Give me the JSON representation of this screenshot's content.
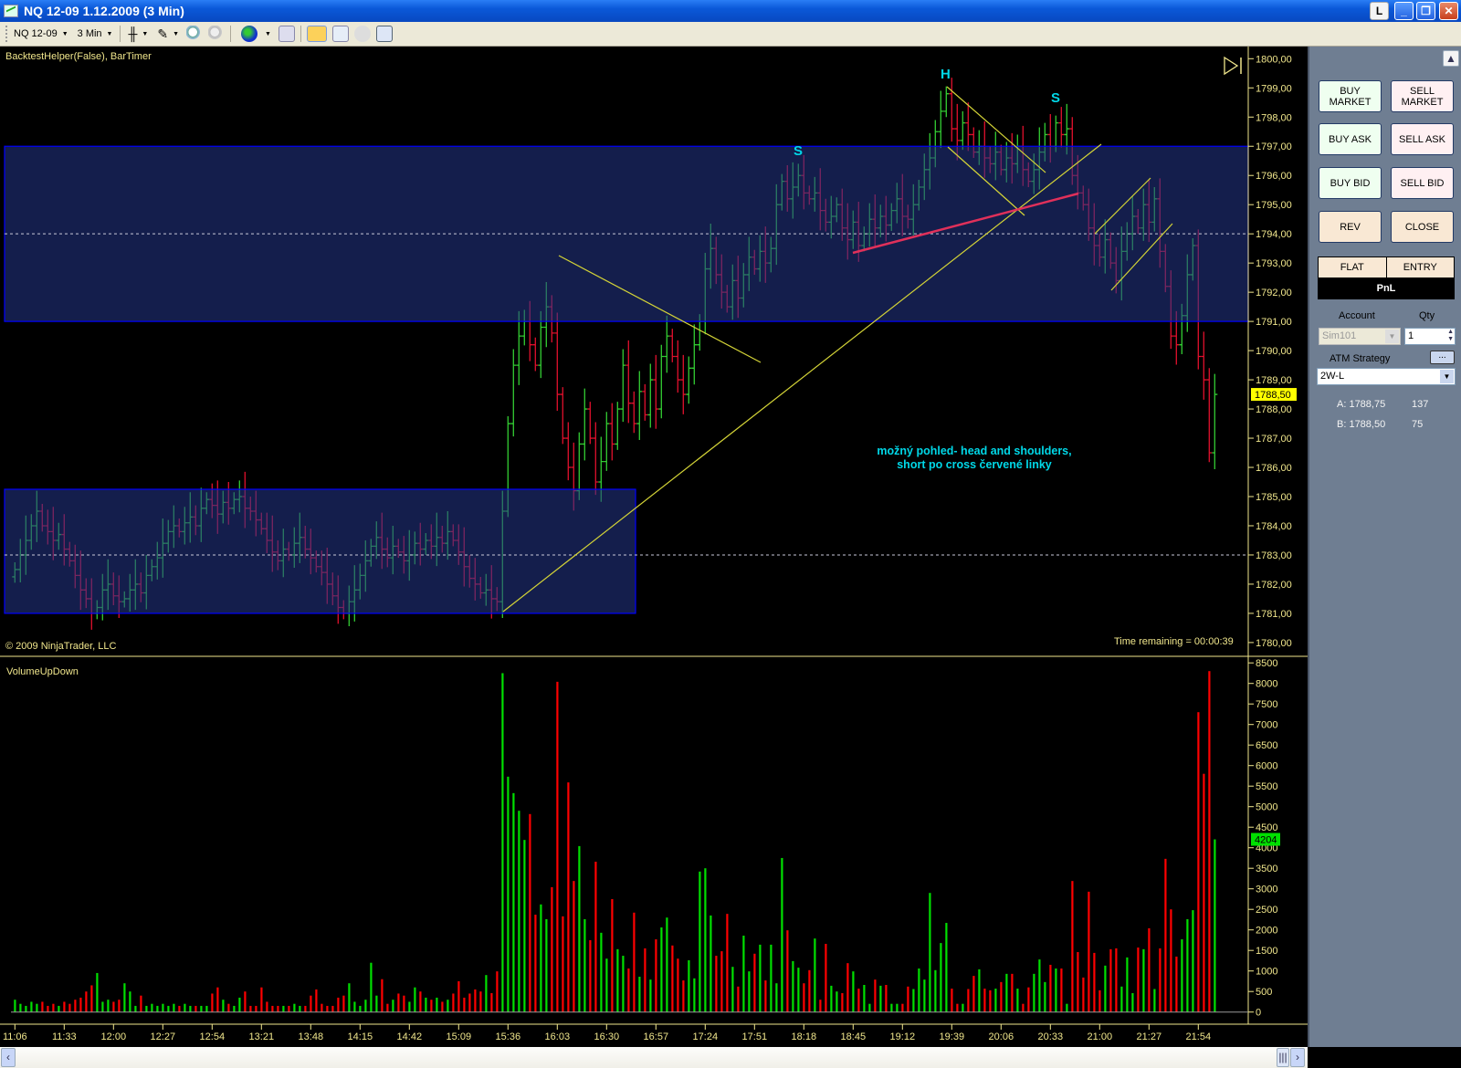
{
  "window": {
    "title": "NQ 12-09  1.12.2009 (3 Min)",
    "btn_l": "L",
    "btn_min": "_",
    "btn_max": "❐",
    "btn_close": "✕"
  },
  "toolbar": {
    "instrument": "NQ 12-09",
    "interval": "3 Min"
  },
  "chart": {
    "indicator_label": "BacktestHelper(False), BarTimer",
    "copyright": "© 2009 NinjaTrader, LLC",
    "time_remaining": "Time remaining = 00:00:39",
    "volume_label": "VolumeUpDown",
    "annotation_line1": "možný pohled- head and shoulders,",
    "annotation_line2": "short po cross červené linky",
    "pattern_labels": {
      "left_shoulder": "S",
      "head": "H",
      "right_shoulder": "S"
    },
    "current_price_label": "1788,50",
    "current_volume_label": "4204",
    "colors": {
      "up": "#32cd32",
      "down": "#e0102c",
      "box_fill": "#24378a",
      "box_stroke": "#0000ff",
      "axis": "#f0e68c",
      "annotation": "#00d8e8",
      "price_tag": "#ffff00",
      "volume_tag": "#00e000"
    }
  },
  "chart_data": {
    "type": "ohlc+volume",
    "title": "NQ 12-09 1.12.2009 (3 Min)",
    "price_ylim": [
      1780,
      1800
    ],
    "price_ticks": [
      "1800,00",
      "1799,00",
      "1798,00",
      "1797,00",
      "1796,00",
      "1795,00",
      "1794,00",
      "1793,00",
      "1792,00",
      "1791,00",
      "1790,00",
      "1789,00",
      "1788,00",
      "1787,00",
      "1786,00",
      "1785,00",
      "1784,00",
      "1783,00",
      "1782,00",
      "1781,00",
      "1780,00"
    ],
    "volume_ylim": [
      0,
      8500
    ],
    "volume_ticks": [
      "8500",
      "8000",
      "7500",
      "7000",
      "6500",
      "6000",
      "5500",
      "5000",
      "4500",
      "4000",
      "3500",
      "3000",
      "2500",
      "2000",
      "1500",
      "1000",
      "500",
      "0"
    ],
    "time_ticks": [
      "11:06",
      "11:33",
      "12:00",
      "12:27",
      "12:54",
      "13:21",
      "13:48",
      "14:15",
      "14:42",
      "15:09",
      "15:36",
      "16:03",
      "16:30",
      "16:57",
      "17:24",
      "17:51",
      "18:18",
      "18:45",
      "19:12",
      "19:39",
      "20:06",
      "20:33",
      "21:00",
      "21:27",
      "21:54"
    ],
    "zones": [
      {
        "from": 1791,
        "to": 1797
      },
      {
        "from": 1781,
        "to": 1785.25
      }
    ],
    "close": [
      1782.5,
      1783,
      1783.5,
      1784,
      1784.5,
      1784,
      1783.8,
      1783.5,
      1783.7,
      1783.2,
      1782.8,
      1782.3,
      1781.8,
      1781.5,
      1781,
      1781.2,
      1781.8,
      1782,
      1781.6,
      1781.4,
      1781.5,
      1781.8,
      1782,
      1781.7,
      1782.3,
      1782.6,
      1782.9,
      1783.4,
      1783.8,
      1784,
      1783.8,
      1784.1,
      1784.3,
      1784,
      1784.6,
      1784.9,
      1784.7,
      1784.4,
      1784.8,
      1784.6,
      1784.9,
      1785,
      1784.6,
      1784.5,
      1784.2,
      1783.9,
      1783.5,
      1783.1,
      1782.8,
      1783.2,
      1783,
      1783.4,
      1783.6,
      1783.2,
      1782.9,
      1782.6,
      1782.4,
      1782,
      1781.6,
      1781.2,
      1781,
      1781.4,
      1781.8,
      1782.3,
      1782.8,
      1783.3,
      1783.6,
      1783.2,
      1782.9,
      1783.3,
      1783.1,
      1782.8,
      1783,
      1783.4,
      1783.2,
      1783.5,
      1783.3,
      1783.6,
      1783.4,
      1783.8,
      1783.5,
      1783.1,
      1782.6,
      1782.2,
      1782,
      1781.7,
      1781.8,
      1781.5,
      1781.4,
      1784.5,
      1787.5,
      1789.5,
      1790.5,
      1791,
      1790.2,
      1789.5,
      1790.8,
      1791.5,
      1790.6,
      1788.5,
      1787,
      1786,
      1785.2,
      1786.8,
      1788,
      1787,
      1785.5,
      1786.2,
      1787.5,
      1786.8,
      1788,
      1789.5,
      1788.2,
      1787.5,
      1788.6,
      1787.8,
      1789,
      1788,
      1789.8,
      1790.5,
      1789.8,
      1789,
      1788.5,
      1789.4,
      1790.2,
      1791,
      1792.8,
      1793.5,
      1792.6,
      1792,
      1791.5,
      1792.4,
      1791.8,
      1792.6,
      1793.2,
      1792.8,
      1793.4,
      1793,
      1793.5,
      1795,
      1795.8,
      1795.2,
      1795.6,
      1796,
      1795.4,
      1795.2,
      1795.4,
      1794.8,
      1794.4,
      1794.6,
      1795,
      1794.2,
      1793.8,
      1794.4,
      1793.6,
      1794,
      1794.5,
      1794.2,
      1794.6,
      1794.3,
      1794.8,
      1795.2,
      1794.6,
      1794.5,
      1795,
      1795.6,
      1796.2,
      1796.6,
      1797.5,
      1798.2,
      1798.8,
      1797.6,
      1797.2,
      1797.8,
      1797.4,
      1796.8,
      1797,
      1796.6,
      1796.4,
      1796.8,
      1796.2,
      1796.6,
      1796.4,
      1797,
      1796.2,
      1795.8,
      1796.2,
      1796.8,
      1797.4,
      1797,
      1797.8,
      1797.4,
      1797.6,
      1796,
      1795.4,
      1795,
      1794.2,
      1793.6,
      1793.2,
      1793.8,
      1793,
      1792.4,
      1793.4,
      1794,
      1794.6,
      1794.2,
      1795,
      1794.4,
      1795.2,
      1793.4,
      1792.2,
      1790.5,
      1790.2,
      1791.2,
      1792.6,
      1793.6,
      1789.8,
      1789,
      1786.5,
      1788.5
    ],
    "volume": [
      300,
      200,
      150,
      250,
      200,
      250,
      150,
      200,
      150,
      250,
      200,
      300,
      350,
      500,
      650,
      950,
      250,
      300,
      250,
      300,
      700,
      500,
      150,
      400,
      150,
      200,
      150,
      200,
      150,
      200,
      150,
      200,
      150,
      150,
      150,
      150,
      450,
      600,
      300,
      200,
      150,
      350,
      500,
      150,
      150,
      600,
      250,
      150,
      150,
      150,
      150,
      200,
      150,
      150,
      400,
      550,
      200,
      150,
      150,
      350,
      400,
      700,
      250,
      150,
      300,
      1200,
      400,
      800,
      200,
      300,
      450,
      400,
      250,
      600,
      500,
      350,
      300,
      350,
      250,
      300,
      450,
      750,
      350,
      450,
      550,
      500,
      900,
      460,
      990,
      8250,
      5730,
      5330,
      4900,
      4190,
      4820,
      2370,
      2620,
      2260,
      3040,
      8040,
      2330,
      5590,
      3190,
      4040,
      2260,
      1750,
      3660,
      1930,
      1300,
      2750,
      1530,
      1370,
      1060,
      2420,
      860,
      1550,
      790,
      1770,
      2060,
      2300,
      1620,
      1300,
      770,
      1260,
      820,
      3420,
      3500,
      2350,
      1370,
      1480,
      2390,
      1100,
      620,
      1860,
      990,
      1420,
      1640,
      770,
      1640,
      700,
      3750,
      1990,
      1240,
      1080,
      700,
      1020,
      1790,
      300,
      1660,
      640,
      500,
      460,
      1190,
      990,
      570,
      660,
      200,
      790,
      640,
      660,
      200,
      200,
      200,
      620,
      560,
      1060,
      790,
      2900,
      1020,
      1680,
      2170,
      570,
      200,
      200,
      560,
      880,
      1040,
      570,
      530,
      570,
      730,
      930,
      930,
      570,
      200,
      600,
      930,
      1280,
      730,
      1150,
      1060,
      1060,
      200,
      3190,
      1460,
      840,
      2930,
      1440,
      530,
      1130,
      1530,
      1550,
      620,
      1330,
      460,
      1570,
      1530,
      2040,
      560,
      1550,
      3730,
      2500,
      1350,
      1770,
      2260,
      2480,
      7300,
      5800,
      8300,
      4204
    ]
  },
  "panel": {
    "buy_market": "BUY MARKET",
    "sell_market": "SELL MARKET",
    "buy_ask": "BUY ASK",
    "sell_ask": "SELL ASK",
    "buy_bid": "BUY BID",
    "sell_bid": "SELL BID",
    "rev": "REV",
    "close": "CLOSE",
    "position": "FLAT",
    "entry": "ENTRY",
    "pnl": "PnL",
    "account_label": "Account",
    "account_value": "Sim101",
    "qty_label": "Qty",
    "qty_value": "1",
    "atm_label": "ATM Strategy",
    "atm_button": "...",
    "atm_value": "2W-L",
    "ask_label": "A: 1788,75",
    "ask_size": "137",
    "bid_label": "B: 1788,50",
    "bid_size": "75"
  }
}
